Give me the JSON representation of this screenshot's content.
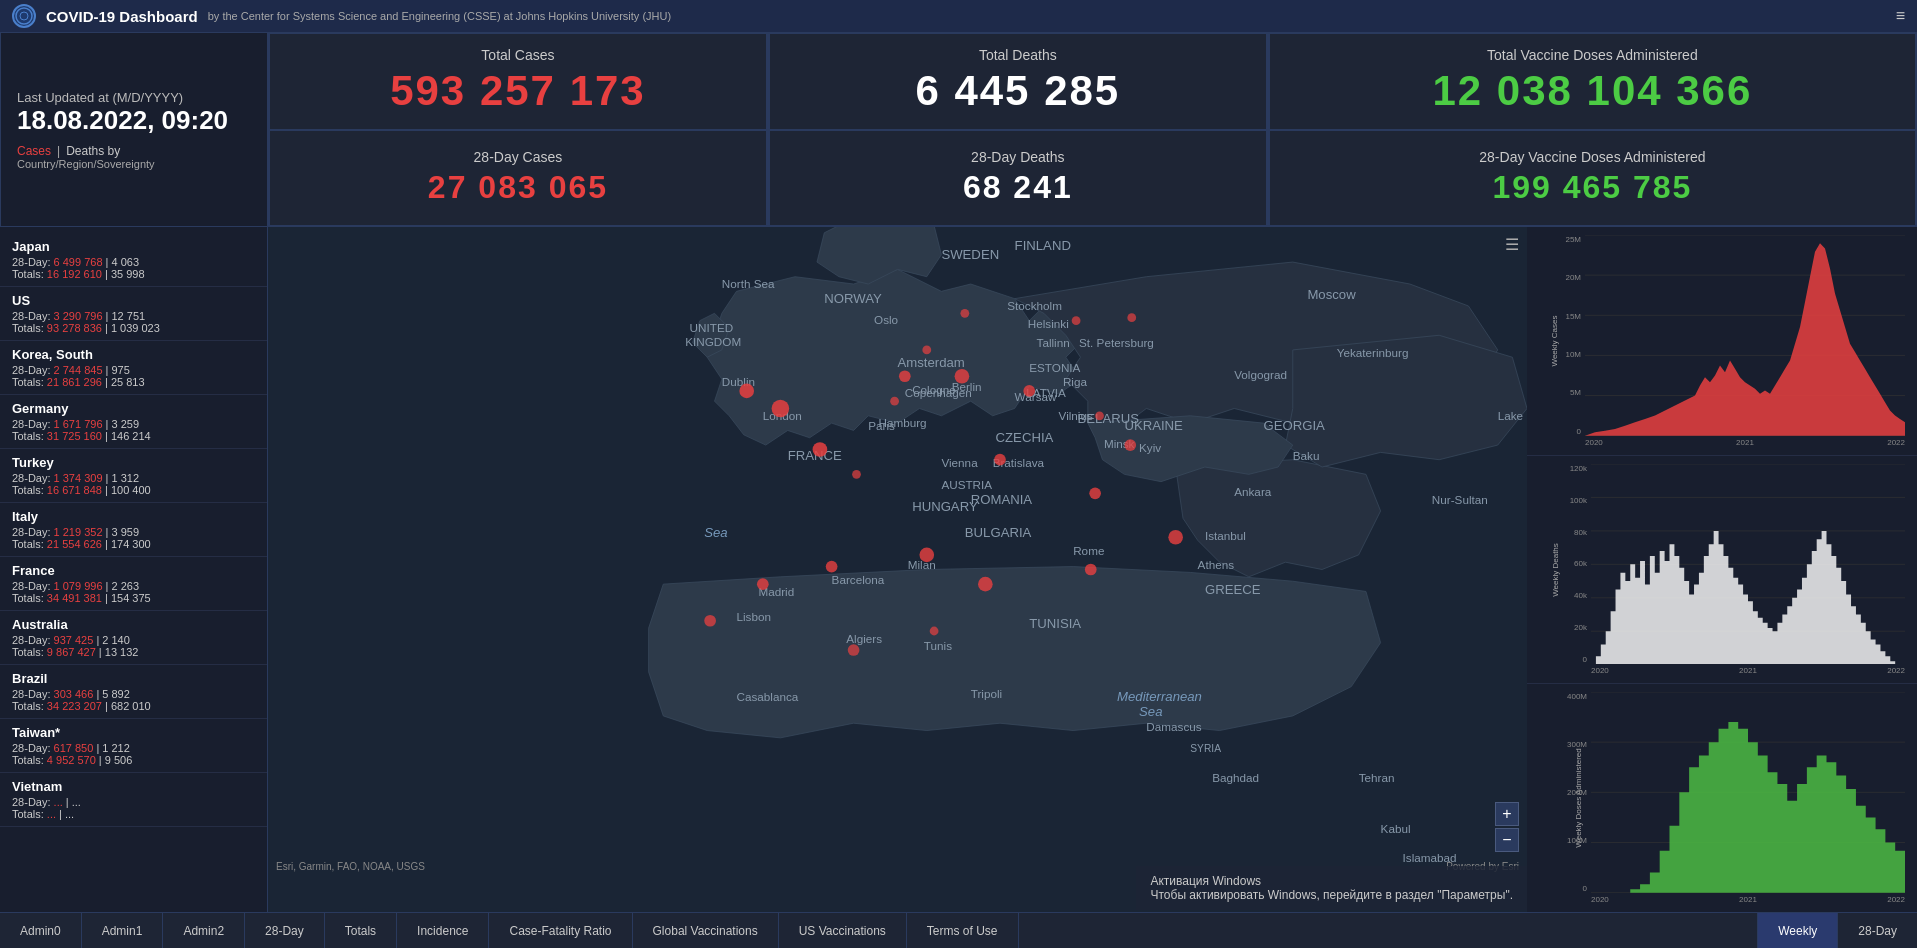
{
  "header": {
    "logo_text": "JHU",
    "title": "COVID-19 Dashboard",
    "subtitle": "by the Center for Systems Science and Engineering (CSSE) at Johns Hopkins University (JHU)",
    "menu_icon": "≡"
  },
  "last_updated": {
    "label": "Last Updated at (M/D/YYYY)",
    "date": "18.08.2022, 09:20"
  },
  "legend": {
    "cases": "Cases",
    "sep": "|",
    "deaths": "Deaths by",
    "country_label": "Country/Region/Sovereignty"
  },
  "stats": {
    "total_cases_label": "Total Cases",
    "total_cases_value": "593 257 173",
    "total_deaths_label": "Total Deaths",
    "total_deaths_value": "6 445 285",
    "total_vaccine_label": "Total Vaccine Doses Administered",
    "total_vaccine_value": "12 038 104 366",
    "day28_cases_label": "28-Day Cases",
    "day28_cases_value": "27 083 065",
    "day28_deaths_label": "28-Day Deaths",
    "day28_deaths_value": "68 241",
    "day28_vaccine_label": "28-Day Vaccine Doses Administered",
    "day28_vaccine_value": "199 465 785"
  },
  "countries": [
    {
      "name": "Japan",
      "day28_cases": "6 499 768",
      "day28_deaths": "4 063",
      "total_cases": "16 192 610",
      "total_deaths": "35 998"
    },
    {
      "name": "US",
      "day28_cases": "3 290 796",
      "day28_deaths": "12 751",
      "total_cases": "93 278 836",
      "total_deaths": "1 039 023"
    },
    {
      "name": "Korea, South",
      "day28_cases": "2 744 845",
      "day28_deaths": "975",
      "total_cases": "21 861 296",
      "total_deaths": "25 813"
    },
    {
      "name": "Germany",
      "day28_cases": "1 671 796",
      "day28_deaths": "3 259",
      "total_cases": "31 725 160",
      "total_deaths": "146 214"
    },
    {
      "name": "Turkey",
      "day28_cases": "1 374 309",
      "day28_deaths": "1 312",
      "total_cases": "16 671 848",
      "total_deaths": "100 400"
    },
    {
      "name": "Italy",
      "day28_cases": "1 219 352",
      "day28_deaths": "3 959",
      "total_cases": "21 554 626",
      "total_deaths": "174 300"
    },
    {
      "name": "France",
      "day28_cases": "1 079 996",
      "day28_deaths": "2 263",
      "total_cases": "34 491 381",
      "total_deaths": "154 375"
    },
    {
      "name": "Australia",
      "day28_cases": "937 425",
      "day28_deaths": "2 140",
      "total_cases": "9 867 427",
      "total_deaths": "13 132"
    },
    {
      "name": "Brazil",
      "day28_cases": "303 466",
      "day28_deaths": "5 892",
      "total_cases": "34 223 207",
      "total_deaths": "682 010"
    },
    {
      "name": "Taiwan*",
      "day28_cases": "617 850",
      "day28_deaths": "1 212",
      "total_cases": "4 952 570",
      "total_deaths": "9 506"
    },
    {
      "name": "Vietnam",
      "day28_cases": "...",
      "day28_deaths": "...",
      "total_cases": "...",
      "total_deaths": "..."
    }
  ],
  "charts": {
    "weekly_cases": {
      "y_label": "Weekly Cases",
      "y_ticks": [
        "25M",
        "20M",
        "15M",
        "10M",
        "5M",
        "0"
      ],
      "x_ticks": [
        "2020",
        "2021",
        "2022"
      ],
      "color": "#e84040"
    },
    "weekly_deaths": {
      "y_label": "Weekly Deaths",
      "y_ticks": [
        "120k",
        "100k",
        "80k",
        "60k",
        "40k",
        "20k",
        "0"
      ],
      "x_ticks": [
        "2020",
        "2021",
        "2022"
      ],
      "color": "#ffffff"
    },
    "weekly_vaccine": {
      "y_label": "Weekly Doses Administered",
      "y_ticks": [
        "400M",
        "300M",
        "200M",
        "100M",
        "0"
      ],
      "x_ticks": [
        "2020",
        "2021",
        "2022"
      ],
      "color": "#4cbb44"
    }
  },
  "map": {
    "attribution": "Esri, Garmin, FAO, NOAA, USGS",
    "powered_by": "Powered by Esri"
  },
  "bottom_nav": {
    "left_items": [
      "Admin0",
      "Admin1",
      "Admin2",
      "28-Day",
      "Totals",
      "Incidence",
      "Case-Fatality Ratio",
      "Global Vaccinations",
      "US Vaccinations",
      "Terms of Use"
    ],
    "right_items": [
      "Weekly",
      "28-Day"
    ]
  },
  "windows_activation": {
    "line1": "Активация Windows",
    "line2": "Чтобы активировать Windows, перейдите в раздел \"Параметры\"."
  }
}
